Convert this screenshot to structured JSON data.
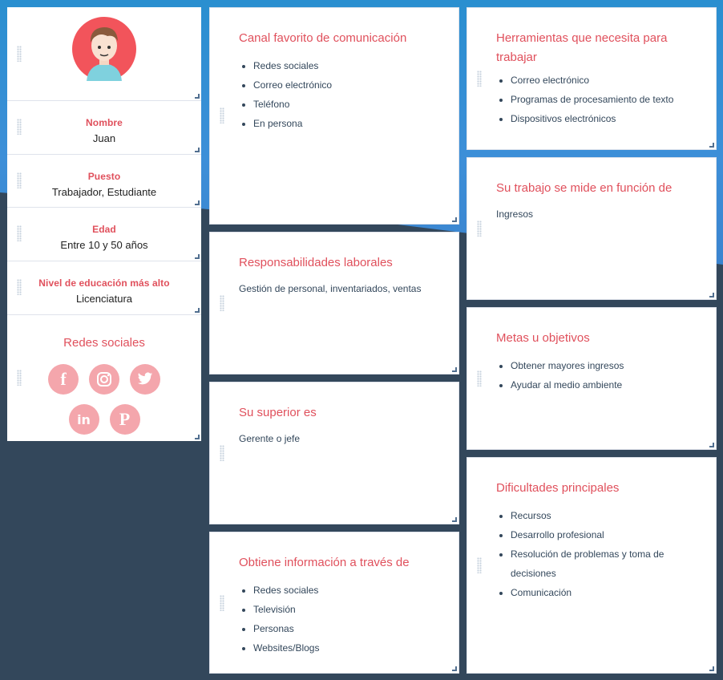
{
  "profile": {
    "fields": [
      {
        "label": "Nombre",
        "value": "Juan"
      },
      {
        "label": "Puesto",
        "value": "Trabajador, Estudiante"
      },
      {
        "label": "Edad",
        "value": "Entre 10 y 50 años"
      },
      {
        "label": "Nivel de educación más alto",
        "value": "Licenciatura"
      }
    ],
    "social_title": "Redes sociales",
    "social_icons": [
      "facebook-icon",
      "instagram-icon",
      "twitter-icon",
      "linkedin-icon",
      "pinterest-icon"
    ]
  },
  "cards": {
    "canal": {
      "title": "Canal favorito de comunicación",
      "items": [
        "Redes sociales",
        "Correo electrónico",
        "Teléfono",
        "En persona"
      ]
    },
    "responsabilidades": {
      "title": "Responsabilidades laborales",
      "text": "Gestión de personal, inventariados, ventas"
    },
    "superior": {
      "title": "Su superior es",
      "text": "Gerente o jefe"
    },
    "informacion": {
      "title": "Obtiene información a través de",
      "items": [
        "Redes sociales",
        "Televisión",
        "Personas",
        "Websites/Blogs"
      ]
    },
    "herramientas": {
      "title": "Herramientas que necesita para trabajar",
      "items": [
        "Correo electrónico",
        "Programas de procesamiento de texto",
        "Dispositivos electrónicos"
      ]
    },
    "medicion": {
      "title": "Su trabajo se mide en función de",
      "text": "Ingresos"
    },
    "metas": {
      "title": "Metas u objetivos",
      "items": [
        "Obtener mayores ingresos",
        "Ayudar al medio ambiente"
      ]
    },
    "dificultades": {
      "title": "Dificultades principales",
      "items": [
        "Recursos",
        "Desarrollo profesional",
        "Resolución de problemas y toma de decisiones",
        "Comunicación"
      ]
    }
  },
  "colors": {
    "accent": "#e0505c",
    "background": "#33475b",
    "header": "#2a8fd0",
    "social": "#f4a6ac"
  }
}
